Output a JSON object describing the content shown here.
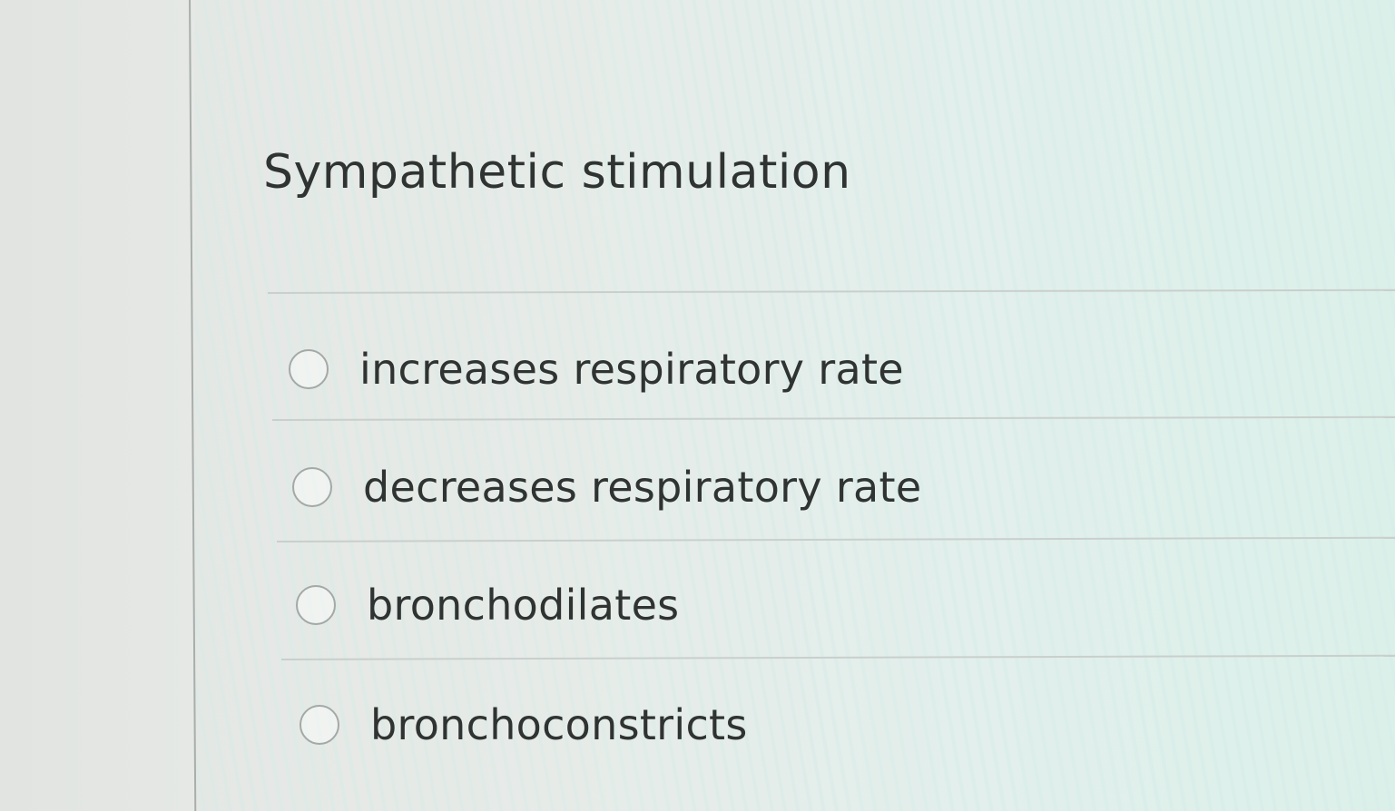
{
  "question": {
    "title": "Sympathetic stimulation",
    "options": [
      {
        "label": "increases respiratory rate",
        "selected": false
      },
      {
        "label": "decreases respiratory rate",
        "selected": false
      },
      {
        "label": "bronchodilates",
        "selected": false
      },
      {
        "label": "bronchoconstricts",
        "selected": false
      }
    ]
  },
  "colors": {
    "text": "#2f3331",
    "radio_border": "#a3a9a6",
    "divider": "#c9cfcc"
  }
}
